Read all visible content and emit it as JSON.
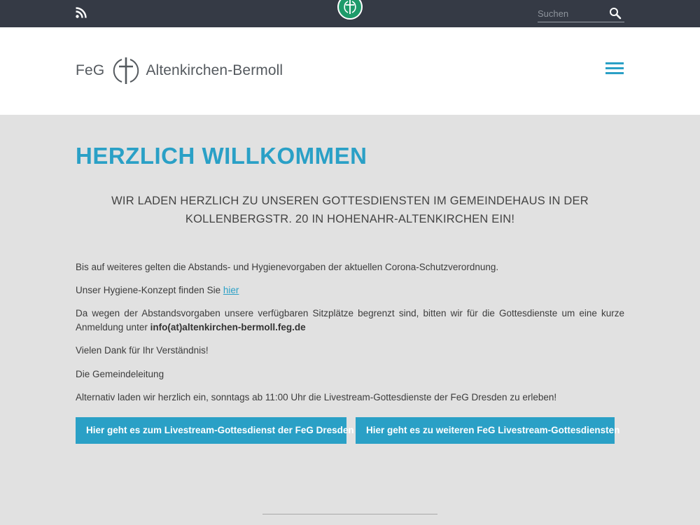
{
  "topbar": {
    "search_placeholder": "Suchen"
  },
  "header": {
    "brand_prefix": "FeG",
    "brand_name": "Altenkirchen-Bermoll"
  },
  "colors": {
    "accent": "#2aa0c6",
    "topbar": "#353a45",
    "page_bg": "#e1e1e1",
    "logo_green": "#1e9b6a"
  },
  "icons": {
    "rss": "rss-icon",
    "search": "search-icon",
    "menu": "hamburger-menu-icon",
    "logo": "cross-circle-icon"
  },
  "main": {
    "title": "HERZLICH WILLKOMMEN",
    "lead": "WIR LADEN HERZLICH ZU UNSEREN GOTTESDIENSTEN IM GEMEINDEHAUS IN DER KOLLENBERGSTR. 20 IN HOHENAHR-ALTENKIRCHEN EIN!",
    "p1": "Bis auf weiteres gelten die  Abstands- und Hygienevorgaben der aktuellen Corona-Schutzverordnung.",
    "p2_text": "Unser Hygiene-Konzept finden Sie ",
    "p2_link": "hier",
    "p3_text": "Da wegen der Abstandsvorgaben unsere verfügbaren Sitzplätze begrenzt sind, bitten wir für die Gottesdienste um eine kurze Anmeldung unter ",
    "p3_email": "info(at)altenkirchen-bermoll.feg.de",
    "p4": "Vielen Dank für Ihr Verständnis!",
    "p5": "Die Gemeindeleitung",
    "p6": "Alternativ laden wir herzlich ein, sonntags ab 11:00 Uhr die Livestream-Gottesdienste der FeG Dresden zu erleben!",
    "button1": "Hier geht es zum Livestream-Gottesdienst der FeG Dresden",
    "button2": "Hier geht es zu weiteren FeG Livestream-Gottesdiensten"
  }
}
